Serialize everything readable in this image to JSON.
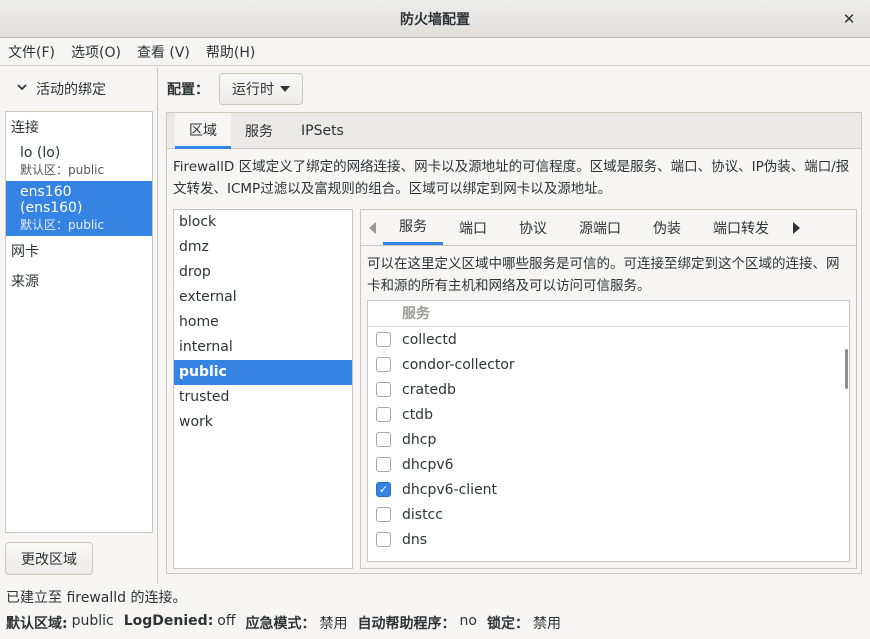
{
  "window": {
    "title": "防火墙配置"
  },
  "menu": [
    "文件(F)",
    "选项(O)",
    "查看 (V)",
    "帮助(H)"
  ],
  "left": {
    "toggle_label": "活动的绑定",
    "sections": {
      "connections": "连接",
      "nic": "网卡",
      "source": "来源"
    },
    "connections": [
      {
        "name": "lo (lo)",
        "zone": "默认区：public",
        "selected": false
      },
      {
        "name": "ens160 (ens160)",
        "zone": "默认区：public",
        "selected": true
      }
    ],
    "change_zone_button": "更改区域"
  },
  "config": {
    "label": "配置：",
    "value": "运行时"
  },
  "tabs": [
    "区域",
    "服务",
    "IPSets"
  ],
  "zone_description": "FirewallD 区域定义了绑定的网络连接、网卡以及源地址的可信程度。区域是服务、端口、协议、IP伪装、端口/报文转发、ICMP过滤以及富规则的组合。区域可以绑定到网卡以及源地址。",
  "zones": [
    "block",
    "dmz",
    "drop",
    "external",
    "home",
    "internal",
    "public",
    "trusted",
    "work"
  ],
  "selected_zone": "public",
  "subtabs": [
    "服务",
    "端口",
    "协议",
    "源端口",
    "伪装",
    "端口转发"
  ],
  "services_description": "可以在这里定义区域中哪些服务是可信的。可连接至绑定到这个区域的连接、网卡和源的所有主机和网络及可以访问可信服务。",
  "services_header": "服务",
  "services": [
    {
      "name": "collectd",
      "checked": false
    },
    {
      "name": "condor-collector",
      "checked": false
    },
    {
      "name": "cratedb",
      "checked": false
    },
    {
      "name": "ctdb",
      "checked": false
    },
    {
      "name": "dhcp",
      "checked": false
    },
    {
      "name": "dhcpv6",
      "checked": false
    },
    {
      "name": "dhcpv6-client",
      "checked": true
    },
    {
      "name": "distcc",
      "checked": false
    },
    {
      "name": "dns",
      "checked": false
    }
  ],
  "status": {
    "connection": "已建立至 firewalld 的连接。",
    "items": [
      {
        "key": "默认区域:",
        "value": "public"
      },
      {
        "key": "LogDenied:",
        "value": "off"
      },
      {
        "key": "应急模式：",
        "value": "禁用"
      },
      {
        "key": "自动帮助程序：",
        "value": "no"
      },
      {
        "key": "锁定：",
        "value": "禁用"
      }
    ]
  }
}
